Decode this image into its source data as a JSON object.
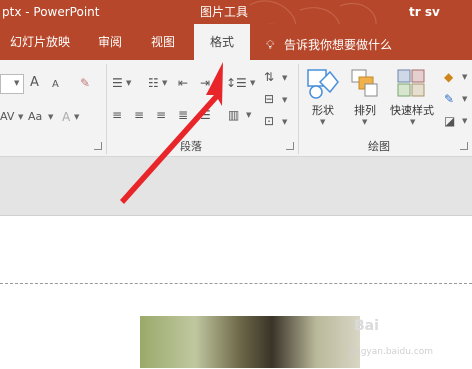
{
  "title_bar": {
    "doc_name": "ptx  -  PowerPoint",
    "context_group": "图片工具",
    "user": "tr sv"
  },
  "tabs": [
    {
      "label": "幻灯片放映"
    },
    {
      "label": "审阅"
    },
    {
      "label": "视图"
    },
    {
      "label": "格式"
    }
  ],
  "active_tab": "格式",
  "tell_me": "告诉我你想要做什么",
  "ribbon": {
    "groups": {
      "paragraph": "段落",
      "drawing": "绘图"
    },
    "buttons": {
      "shapes": "形状",
      "arrange": "排列",
      "quick_styles": "快速样式"
    },
    "font_glyphs": {
      "grow": "A",
      "shrink": "A",
      "case": "Aa"
    }
  },
  "watermark": {
    "brand": "Bai",
    "sub": "jingyan.baidu.com"
  },
  "colors": {
    "ppt_red": "#b7472a",
    "ribbon_bg": "#f3f3f3",
    "arrow_red": "#e8262a"
  }
}
